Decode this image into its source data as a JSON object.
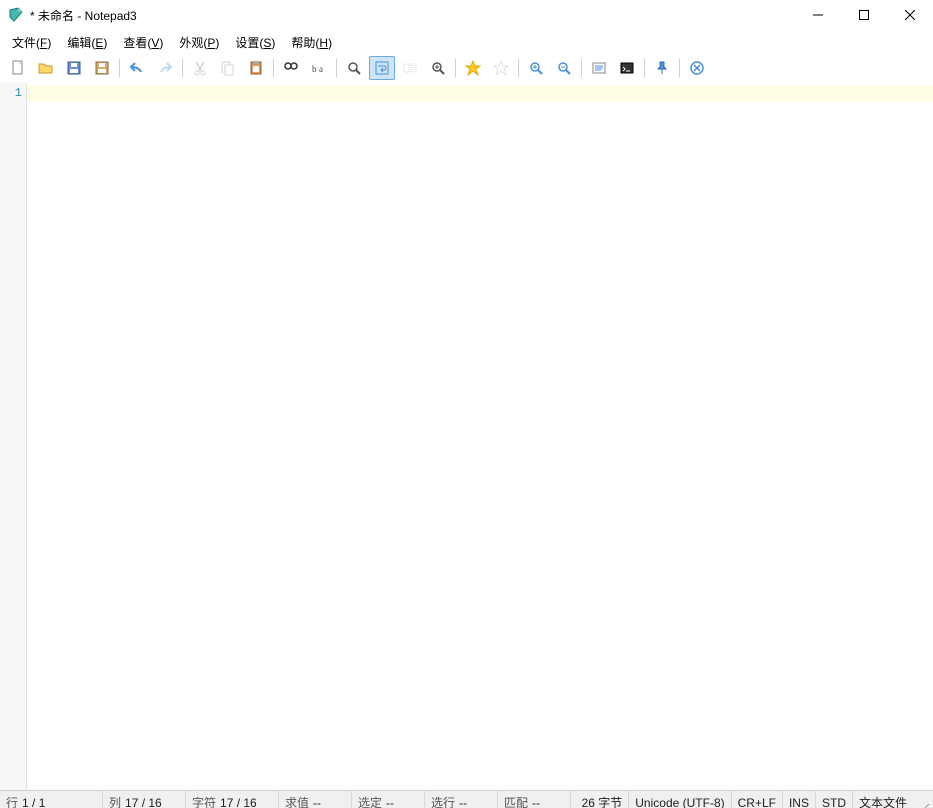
{
  "title": "* 未命名 - Notepad3",
  "menus": {
    "file": "文件(F)",
    "edit": "编辑(E)",
    "view": "查看(V)",
    "appearance": "外观(P)",
    "settings": "设置(S)",
    "help": "帮助(H)"
  },
  "toolbar_icons": [
    "new-file-icon",
    "open-file-icon",
    "save-icon",
    "save-as-icon",
    "sep",
    "undo-icon",
    "redo-icon",
    "sep",
    "cut-icon",
    "copy-icon",
    "paste-icon",
    "sep",
    "find-icon",
    "replace-icon",
    "sep",
    "zoom-icon",
    "word-wrap-icon",
    "show-whitespace-icon",
    "line-numbers-icon",
    "sep",
    "favorite-icon",
    "add-favorite-icon",
    "sep",
    "zoom-in-icon",
    "zoom-out-icon",
    "sep",
    "scheme-icon",
    "console-icon",
    "sep",
    "pin-icon",
    "sep",
    "clear-icon"
  ],
  "editor": {
    "line_number": "1",
    "content": ""
  },
  "status": {
    "line_label": "行",
    "line_value": "1 / 1",
    "col_label": "列",
    "col_value": "17 / 16",
    "char_label": "字符",
    "char_value": "17 / 16",
    "val_label": "求值",
    "val_value": "--",
    "sel_label": "选定",
    "sel_value": "--",
    "sel_line_label": "选行",
    "sel_line_value": "--",
    "match_label": "匹配",
    "match_value": "--",
    "bytes_value": "26 字节",
    "encoding": "Unicode (UTF-8)",
    "eol": "CR+LF",
    "ins": "INS",
    "std": "STD",
    "type": "文本文件"
  }
}
